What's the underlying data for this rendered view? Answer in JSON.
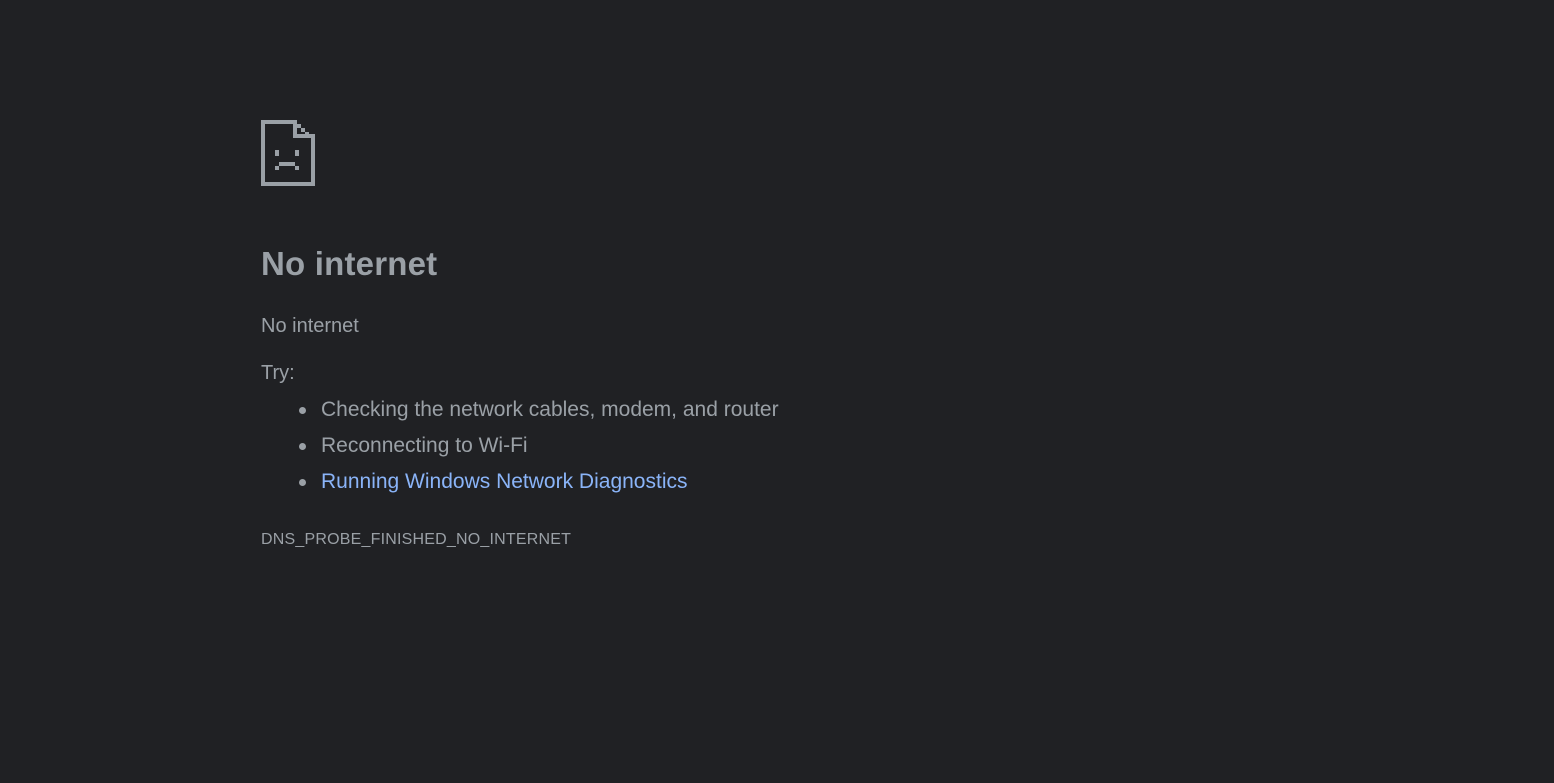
{
  "page": {
    "background_color": "#202124",
    "text_color": "#9aa0a6",
    "link_color": "#8ab4f8"
  },
  "icon": {
    "name": "sad-document-icon"
  },
  "error": {
    "heading": "No internet",
    "summary": "No internet",
    "try_label": "Try:",
    "suggestions": [
      {
        "text": "Checking the network cables, modem, and router",
        "link": false
      },
      {
        "text": "Reconnecting to Wi-Fi",
        "link": false
      },
      {
        "text": "Running Windows Network Diagnostics",
        "link": true
      }
    ],
    "code": "DNS_PROBE_FINISHED_NO_INTERNET"
  }
}
